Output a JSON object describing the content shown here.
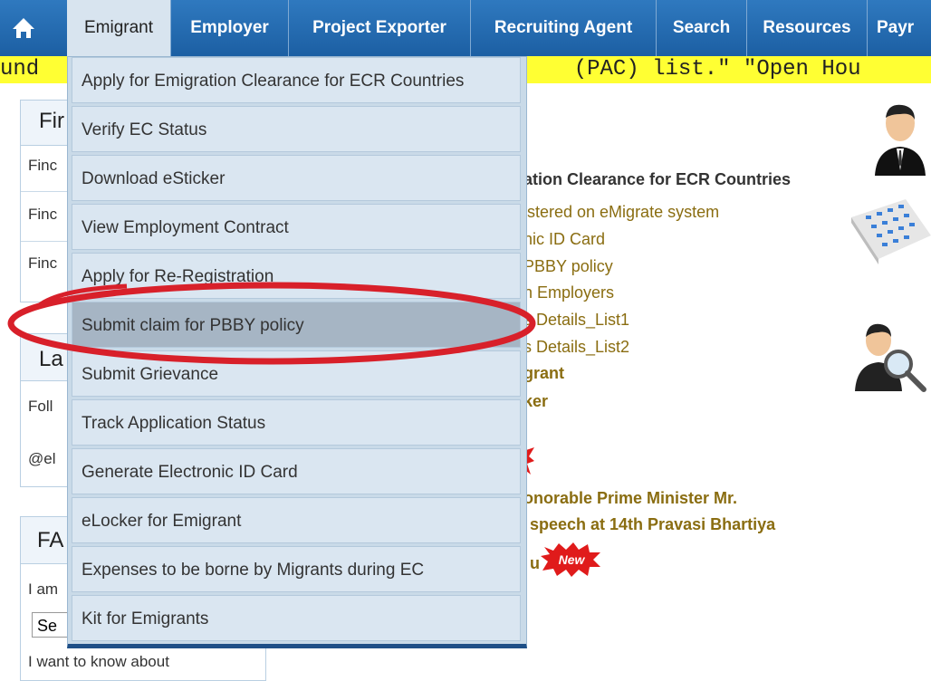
{
  "nav": {
    "tabs": [
      {
        "label": "Emigrant",
        "active": true
      },
      {
        "label": "Employer"
      },
      {
        "label": "Project Exporter"
      },
      {
        "label": "Recruiting Agent"
      },
      {
        "label": "Search"
      },
      {
        "label": "Resources"
      },
      {
        "label": "Payr"
      }
    ],
    "home_icon": "home-icon"
  },
  "marquee": {
    "text": "und                                         (PAC) list.\" \"Open Hou"
  },
  "left": {
    "box1": {
      "heading": "Fir",
      "rows": [
        "Finc",
        "Finc",
        "Finc"
      ]
    },
    "box2": {
      "heading": "La",
      "rows": [
        "Foll",
        "@el"
      ]
    },
    "box3": {
      "heading": "FA",
      "line1": "I am",
      "select_value": "Se",
      "footer": "I want to know about"
    }
  },
  "content": {
    "heading": "ation Clearance for ECR Countries",
    "links": [
      "istered on eMigrate system",
      "nic ID Card",
      "PBBY policy",
      "n Employers",
      "s Details_List1",
      "s Details_List2",
      "grant",
      "ker"
    ],
    "news1": "onorable Prime Minister Mr.",
    "news2": "speech at 14th Pravasi Bhartiya",
    "news3": "u",
    "new_badge": "New"
  },
  "menu": {
    "items": [
      "Apply for Emigration Clearance for ECR Countries",
      "Verify EC Status",
      "Download eSticker",
      "View Employment Contract",
      "Apply for Re-Registration",
      "Submit claim for PBBY policy",
      "Submit Grievance",
      "Track Application Status",
      "Generate Electronic ID Card",
      "eLocker for Emigrant",
      "Expenses to be borne by Migrants during EC",
      "Kit for Emigrants"
    ],
    "highlighted_index": 5
  },
  "colors": {
    "nav": "#1c5fa3",
    "marquee": "#ffff33",
    "annotation": "#d8202a",
    "link": "#8a6d11"
  }
}
